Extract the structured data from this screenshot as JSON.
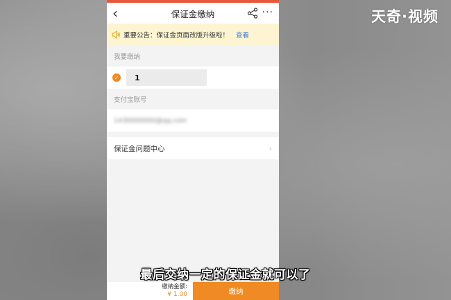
{
  "watermark": "天奇·视频",
  "nav": {
    "title": "保证金缴纳",
    "back_icon": "chevron-left-icon",
    "more_label": "···"
  },
  "notice": {
    "text": "重要公告：保证金页面改版升级啦！",
    "link": "查看"
  },
  "amount_section": {
    "label": "我要缴纳",
    "value": "1"
  },
  "alipay_section": {
    "label": "支付宝账号",
    "value": "1430000000@qq.com"
  },
  "help": {
    "label": "保证金问题中心",
    "chevron": "›"
  },
  "footer": {
    "amount_label": "缴纳金额:",
    "amount_value": "¥ 1.00",
    "pay_label": "缴纳"
  },
  "caption": "最后交纳一定的保证金就可以了",
  "colors": {
    "accent": "#f08a24",
    "status_bar": "#e8573a",
    "notice_bg": "#fdf5d1",
    "link": "#3a7bd5"
  }
}
